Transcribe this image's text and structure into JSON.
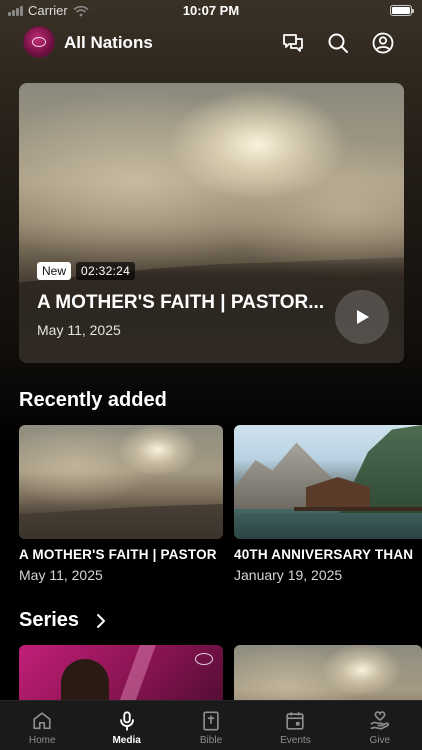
{
  "status_bar": {
    "carrier": "Carrier",
    "time": "10:07 PM"
  },
  "header": {
    "title": "All Nations",
    "icons": [
      "chat-icon",
      "search-icon",
      "profile-icon"
    ]
  },
  "hero": {
    "badge_new": "New",
    "duration": "02:32:24",
    "title": "A MOTHER'S FAITH | PASTOR...",
    "date": "May 11, 2025"
  },
  "recently_added": {
    "heading": "Recently added",
    "items": [
      {
        "title": "A MOTHER'S FAITH | PASTOR",
        "date": "May 11, 2025"
      },
      {
        "title": "40TH ANNIVERSARY THAN",
        "date": "January 19, 2025"
      }
    ]
  },
  "series": {
    "heading": "Series"
  },
  "tabbar": {
    "active": "Media",
    "items": [
      {
        "label": "Home",
        "icon": "home-icon"
      },
      {
        "label": "Media",
        "icon": "microphone-icon"
      },
      {
        "label": "Bible",
        "icon": "bible-icon"
      },
      {
        "label": "Events",
        "icon": "calendar-icon"
      },
      {
        "label": "Give",
        "icon": "give-hand-icon"
      }
    ]
  },
  "colors": {
    "background": "#000000",
    "tabbar": "#1a1a1a",
    "inactive_tab": "#8e8e8e"
  }
}
